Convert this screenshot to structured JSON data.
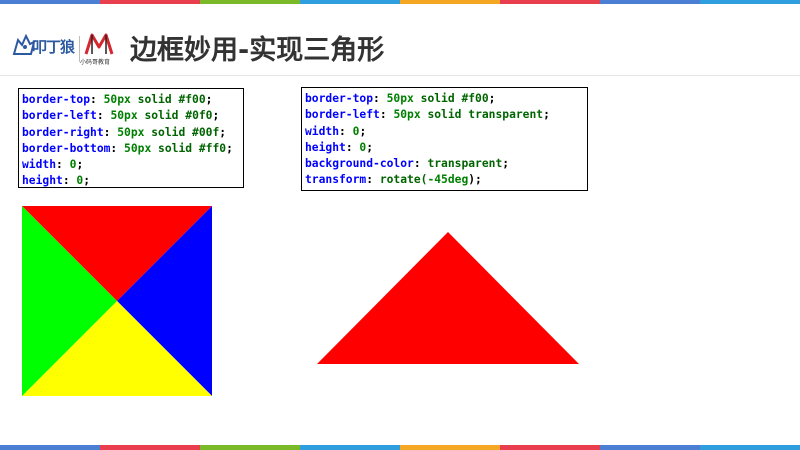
{
  "colors": {
    "stripe": [
      "#4a7fd4",
      "#e83e4d",
      "#7aba28",
      "#2f9ede",
      "#f5a623",
      "#e83e4d",
      "#4a7fd4",
      "#2f9ede"
    ],
    "square_top": "#ff0000",
    "square_left": "#00ff00",
    "square_right": "#0000ff",
    "square_bottom": "#ffff00",
    "triangle": "#ff0000"
  },
  "header": {
    "title": "边框妙用-实现三角形",
    "logo1_text": "叩丁狼",
    "logo2_text": "小码哥教育"
  },
  "code_left": [
    {
      "prop": "border-top",
      "num": "50",
      "unit": "px",
      "val": "solid #f00"
    },
    {
      "prop": "border-left",
      "num": "50",
      "unit": "px",
      "val": "solid #0f0"
    },
    {
      "prop": "border-right",
      "num": "50",
      "unit": "px",
      "val": "solid #00f"
    },
    {
      "prop": "border-bottom",
      "num": "50",
      "unit": "px",
      "val": "solid #ff0"
    },
    {
      "prop": "width",
      "num": "0",
      "unit": "",
      "val": ""
    },
    {
      "prop": "height",
      "num": "0",
      "unit": "",
      "val": ""
    }
  ],
  "code_right": [
    {
      "prop": "border-top",
      "pre": "",
      "num": "50",
      "unit": "px",
      "val": "solid #f00",
      "post": ";"
    },
    {
      "prop": "border-left",
      "pre": "",
      "num": "50",
      "unit": "px",
      "val": "solid transparent",
      "post": ";"
    },
    {
      "prop": "width",
      "pre": "",
      "num": "0",
      "unit": "",
      "val": "",
      "post": ";"
    },
    {
      "prop": "height",
      "pre": "",
      "num": "0",
      "unit": "",
      "val": "",
      "post": ";"
    },
    {
      "prop": "background-color",
      "pre": "",
      "num": "",
      "unit": "",
      "val": "transparent",
      "post": ";"
    },
    {
      "prop": "transform",
      "pre": "rotate(",
      "num": "-45",
      "unit": "deg",
      "val": "",
      "post": ");"
    }
  ]
}
